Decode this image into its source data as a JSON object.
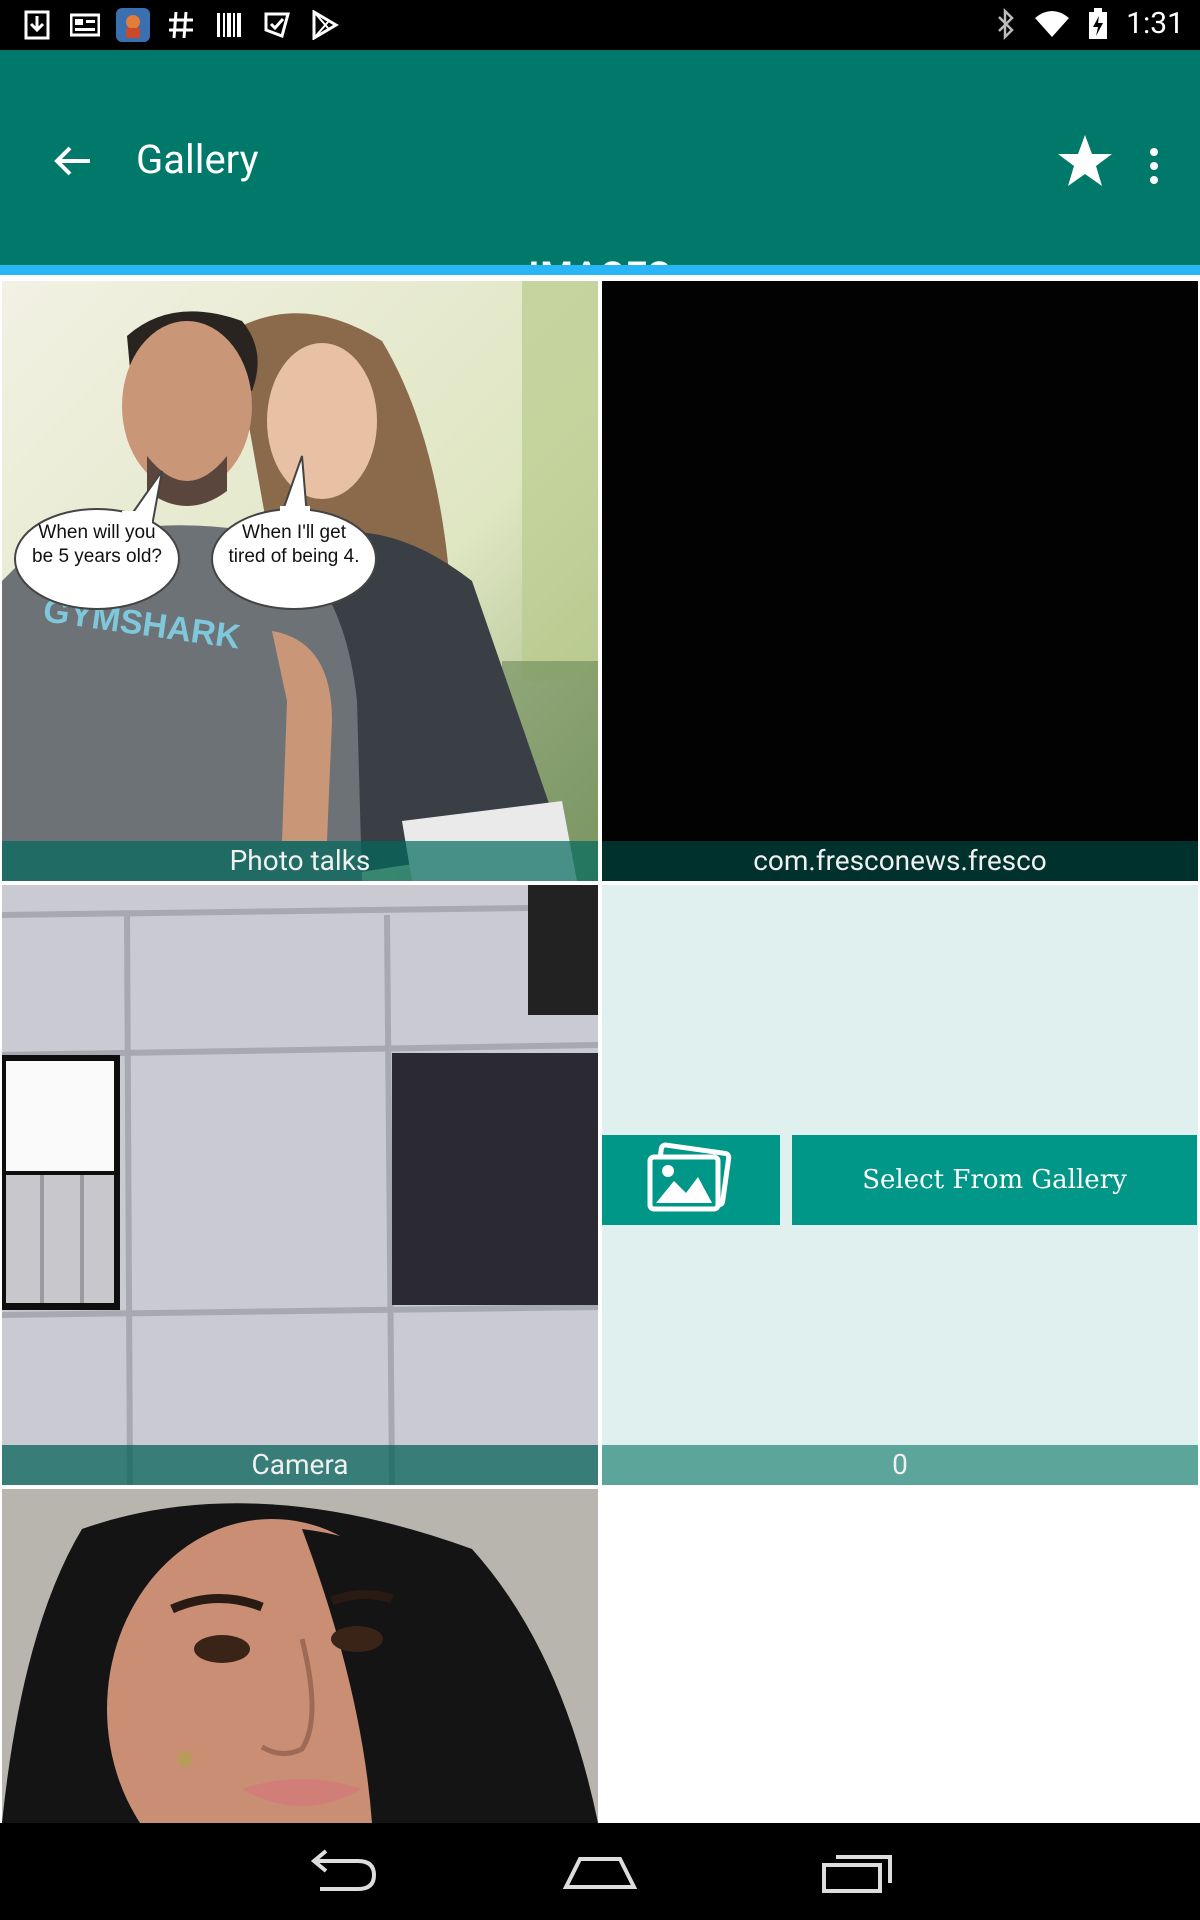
{
  "status_bar": {
    "time": "1:31"
  },
  "app_bar": {
    "title": "Gallery"
  },
  "tabs": [
    {
      "label": "IMAGES"
    }
  ],
  "albums": [
    {
      "caption": "Photo talks",
      "bubbles": [
        "When will you be 5 years old?",
        "When I'll get tired of being 4."
      ]
    },
    {
      "caption": "com.fresconews.fresco"
    },
    {
      "caption": "Camera"
    },
    {
      "caption": "0",
      "button_label": "Select From Gallery"
    }
  ],
  "colors": {
    "app_bar": "#00796b",
    "tab_indicator": "#29b6f6",
    "accent_button": "#009688",
    "panel_bg": "#dff0ef"
  }
}
